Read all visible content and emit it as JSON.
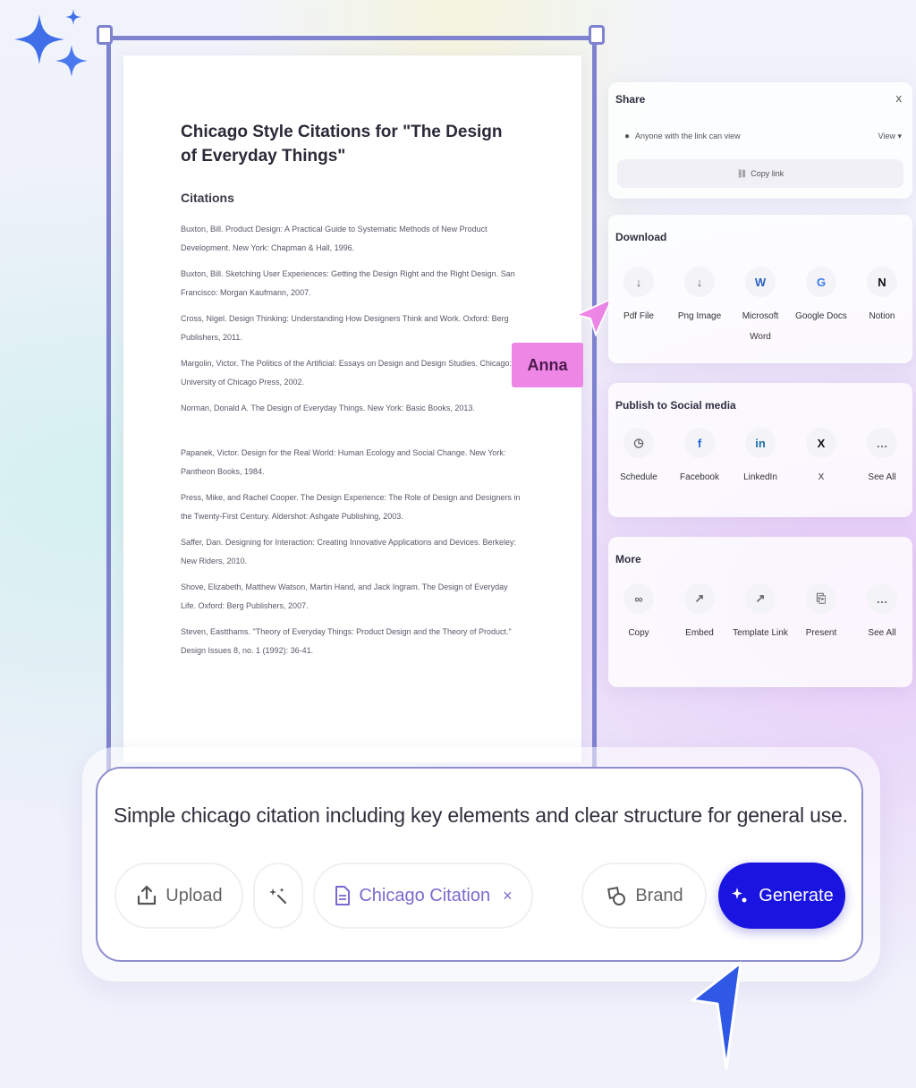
{
  "document": {
    "title": "Chicago Style Citations for \"The Design of Everyday Things\"",
    "subheading": "Citations",
    "citations": [
      "Buxton, Bill. Product Design: A Practical Guide to Systematic Methods of New Product Development. New York: Chapman & Hall, 1996.",
      "Buxton, Bill. Sketching User Experiences: Getting the Design Right and the Right Design. San Francisco: Morgan Kaufmann, 2007.",
      "Cross, Nigel. Design Thinking: Understanding How Designers Think and Work. Oxford: Berg Publishers, 2011.",
      "Margolin, Victor. The Politics of the Artificial: Essays on Design and Design Studies. Chicago: University of Chicago Press, 2002.",
      "Norman, Donald A. The Design of Everyday Things. New York: Basic Books, 2013.",
      "Papanek, Victor. Design for the Real World: Human Ecology and Social Change. New York: Pantheon Books, 1984.",
      "Press, Mike, and Rachel Cooper. The Design Experience: The Role of Design and Designers in the Twenty-First Century. Aldershot: Ashgate Publishing, 2003.",
      "Saffer, Dan. Designing for Interaction: Creating Innovative Applications and Devices. Berkeley: New Riders, 2010.",
      "Shove, Elizabeth, Matthew Watson, Martin Hand, and Jack Ingram. The Design of Everyday Life. Oxford: Berg Publishers, 2007.",
      "Steven, Eastthams. \"Theory of Everyday Things: Product Design and the Theory of Product.\" Design Issues 8, no. 1 (1992): 36-41."
    ]
  },
  "collaborator": {
    "name": "Anna"
  },
  "share": {
    "title": "Share",
    "close_label": "x",
    "access_text": "Anyone with the link can view",
    "permission": "View",
    "copy_link_label": "Copy link"
  },
  "download": {
    "title": "Download",
    "options": [
      {
        "icon": "↓",
        "label": "Pdf File"
      },
      {
        "icon": "↓",
        "label": "Png Image"
      },
      {
        "icon": "W",
        "label": "Microsoft Word"
      },
      {
        "icon": "G",
        "label": "Google Docs"
      },
      {
        "icon": "N",
        "label": "Notion"
      }
    ]
  },
  "social": {
    "title": "Publish to Social media",
    "options": [
      {
        "icon": "◷",
        "label": "Schedule"
      },
      {
        "icon": "f",
        "label": "Facebook"
      },
      {
        "icon": "in",
        "label": "LinkedIn"
      },
      {
        "icon": "X",
        "label": "X"
      },
      {
        "icon": "…",
        "label": "See All"
      }
    ]
  },
  "more": {
    "title": "More",
    "options": [
      {
        "icon": "∞",
        "label": "Copy"
      },
      {
        "icon": "↗",
        "label": "Embed"
      },
      {
        "icon": "↗",
        "label": "Template Link"
      },
      {
        "icon": "⎘",
        "label": "Present"
      },
      {
        "icon": "…",
        "label": "See All"
      }
    ]
  },
  "composer": {
    "prompt": "Simple chicago citation including key elements and clear structure for general use.",
    "upload_label": "Upload",
    "chip_label": "Chicago Citation",
    "chip_close": "×",
    "brand_label": "Brand",
    "generate_label": "Generate"
  },
  "colors": {
    "accent": "#1a14e0",
    "frame": "#7f82cf",
    "collaborator_tag": "#ee86e6",
    "chip_text": "#7a6ad0"
  }
}
